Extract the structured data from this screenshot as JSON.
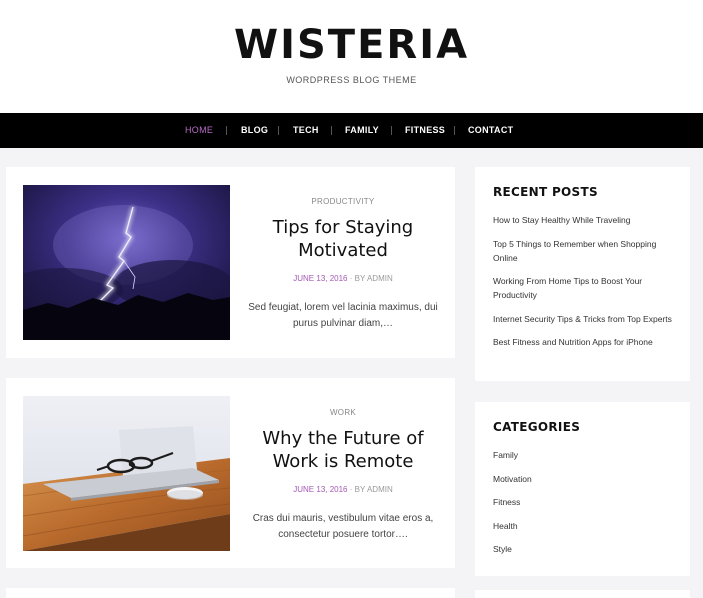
{
  "site": {
    "title": "WISTERIA",
    "tagline": "WORDPRESS BLOG THEME"
  },
  "nav": {
    "items": [
      {
        "label": "HOME",
        "active": true
      },
      {
        "label": "BLOG",
        "active": false
      },
      {
        "label": "TECH",
        "active": false
      },
      {
        "label": "FAMILY",
        "active": false
      },
      {
        "label": "FITNESS",
        "active": false
      },
      {
        "label": "CONTACT",
        "active": false
      }
    ]
  },
  "posts": [
    {
      "category": "PRODUCTIVITY",
      "title": "Tips for Staying Motivated",
      "date": "JUNE 13, 2016",
      "author": "BY ADMIN",
      "excerpt": "Sed feugiat, lorem vel lacinia maximus, dui purus pulvinar diam,…",
      "image": "lightning-storm-photo"
    },
    {
      "category": "WORK",
      "title": "Why the Future of Work is Remote",
      "date": "JUNE 13, 2016",
      "author": "BY ADMIN",
      "excerpt": "Cras dui mauris, vestibulum vitae eros a, consectetur posuere tortor….",
      "image": "laptop-desk-photo"
    }
  ],
  "sidebar": {
    "recent_posts": {
      "title": "RECENT POSTS",
      "items": [
        "How to Stay Healthy While Traveling",
        "Top 5 Things to Remember when Shopping Online",
        "Working From Home Tips to Boost Your Productivity",
        "Internet Security Tips & Tricks from Top Experts",
        "Best Fitness and Nutrition Apps for iPhone"
      ]
    },
    "categories": {
      "title": "CATEGORIES",
      "items": [
        "Family",
        "Motivation",
        "Fitness",
        "Health",
        "Style"
      ]
    }
  },
  "colors": {
    "accent": "#a459b5",
    "nav_bg": "#000000",
    "page_bg": "#f4f3f5"
  }
}
